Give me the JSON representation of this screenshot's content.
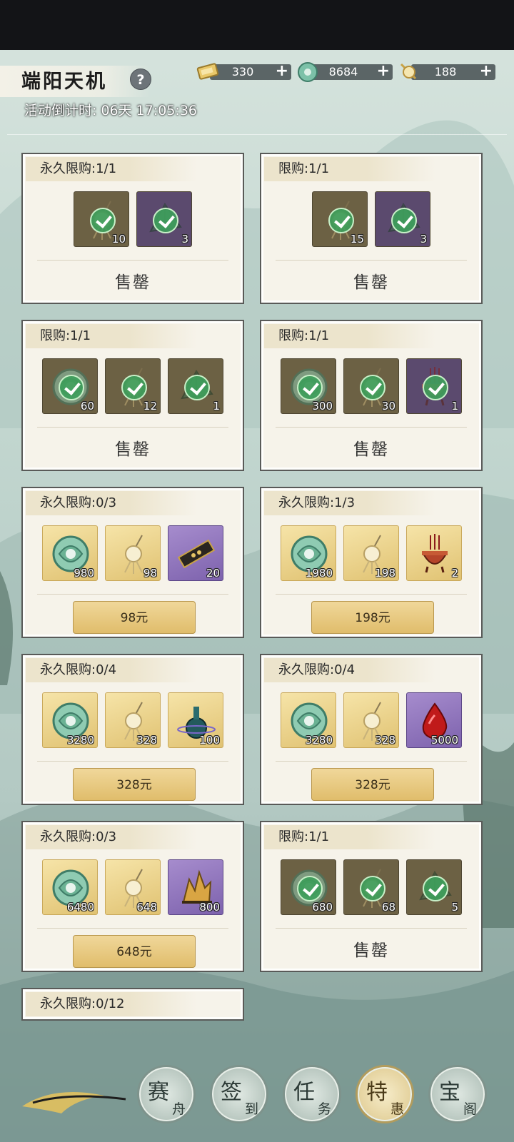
{
  "header": {
    "title": "端阳天机",
    "help_icon": "?",
    "countdown": "活动倒计时: 06天 17:05:36"
  },
  "resources": [
    {
      "icon": "ticket-icon",
      "value": "330",
      "plus": "+"
    },
    {
      "icon": "jade-icon",
      "value": "8684",
      "plus": "+"
    },
    {
      "icon": "coin-pendant-icon",
      "value": "188",
      "plus": "+"
    }
  ],
  "cards": [
    {
      "limit": "永久限购:1/1",
      "state": "sold",
      "label": "售罄",
      "items": [
        {
          "icon": "coin-pendant-icon",
          "count": "10",
          "bg": "gold",
          "sold": true
        },
        {
          "icon": "zongzi-icon",
          "count": "3",
          "bg": "purple",
          "sold": true
        }
      ]
    },
    {
      "limit": "限购:1/1",
      "state": "sold",
      "label": "售罄",
      "items": [
        {
          "icon": "coin-pendant-icon",
          "count": "15",
          "bg": "gold",
          "sold": true
        },
        {
          "icon": "zongzi-icon",
          "count": "3",
          "bg": "purple",
          "sold": true
        }
      ]
    },
    {
      "limit": "限购:1/1",
      "state": "sold",
      "label": "售罄",
      "items": [
        {
          "icon": "jade-icon",
          "count": "60",
          "bg": "gold",
          "sold": true
        },
        {
          "icon": "coin-pendant-icon",
          "count": "12",
          "bg": "gold",
          "sold": true
        },
        {
          "icon": "zongzi-icon",
          "count": "1",
          "bg": "gold",
          "sold": true
        }
      ]
    },
    {
      "limit": "限购:1/1",
      "state": "sold",
      "label": "售罄",
      "items": [
        {
          "icon": "jade-icon",
          "count": "300",
          "bg": "gold",
          "sold": true
        },
        {
          "icon": "coin-pendant-icon",
          "count": "30",
          "bg": "gold",
          "sold": true
        },
        {
          "icon": "incense-burner-icon",
          "count": "1",
          "bg": "purple",
          "sold": true
        }
      ]
    },
    {
      "limit": "永久限购:0/3",
      "state": "buy",
      "label": "98元",
      "items": [
        {
          "icon": "jade-icon",
          "count": "980",
          "bg": "gold"
        },
        {
          "icon": "coin-pendant-icon",
          "count": "98",
          "bg": "gold"
        },
        {
          "icon": "scroll-token-icon",
          "count": "20",
          "bg": "purple"
        }
      ]
    },
    {
      "limit": "永久限购:1/3",
      "state": "buy",
      "label": "198元",
      "items": [
        {
          "icon": "jade-icon",
          "count": "1980",
          "bg": "gold"
        },
        {
          "icon": "coin-pendant-icon",
          "count": "198",
          "bg": "gold"
        },
        {
          "icon": "incense-burner-icon",
          "count": "2",
          "bg": "gold"
        }
      ]
    },
    {
      "limit": "永久限购:0/4",
      "state": "buy",
      "label": "328元",
      "items": [
        {
          "icon": "jade-icon",
          "count": "3280",
          "bg": "gold"
        },
        {
          "icon": "coin-pendant-icon",
          "count": "328",
          "bg": "gold"
        },
        {
          "icon": "vase-icon",
          "count": "100",
          "bg": "gold"
        }
      ]
    },
    {
      "limit": "永久限购:0/4",
      "state": "buy",
      "label": "328元",
      "items": [
        {
          "icon": "jade-icon",
          "count": "3280",
          "bg": "gold"
        },
        {
          "icon": "coin-pendant-icon",
          "count": "328",
          "bg": "gold"
        },
        {
          "icon": "blood-drop-icon",
          "count": "5000",
          "bg": "purple"
        }
      ]
    },
    {
      "limit": "永久限购:0/3",
      "state": "buy",
      "label": "648元",
      "items": [
        {
          "icon": "jade-icon",
          "count": "6480",
          "bg": "gold"
        },
        {
          "icon": "coin-pendant-icon",
          "count": "648",
          "bg": "gold"
        },
        {
          "icon": "crystal-icon",
          "count": "800",
          "bg": "purple"
        }
      ]
    },
    {
      "limit": "限购:1/1",
      "state": "sold",
      "label": "售罄",
      "items": [
        {
          "icon": "jade-icon",
          "count": "680",
          "bg": "gold",
          "sold": true
        },
        {
          "icon": "coin-pendant-icon",
          "count": "68",
          "bg": "gold",
          "sold": true
        },
        {
          "icon": "zongzi-icon",
          "count": "5",
          "bg": "gold",
          "sold": true
        }
      ]
    },
    {
      "limit": "永久限购:0/12",
      "state": "partial",
      "label": "",
      "items": []
    }
  ],
  "nav": [
    {
      "c1": "赛",
      "c2": "舟",
      "active": false
    },
    {
      "c1": "签",
      "c2": "到",
      "active": false
    },
    {
      "c1": "任",
      "c2": "务",
      "active": false
    },
    {
      "c1": "特",
      "c2": "惠",
      "active": true
    },
    {
      "c1": "宝",
      "c2": "阁",
      "active": false
    }
  ]
}
